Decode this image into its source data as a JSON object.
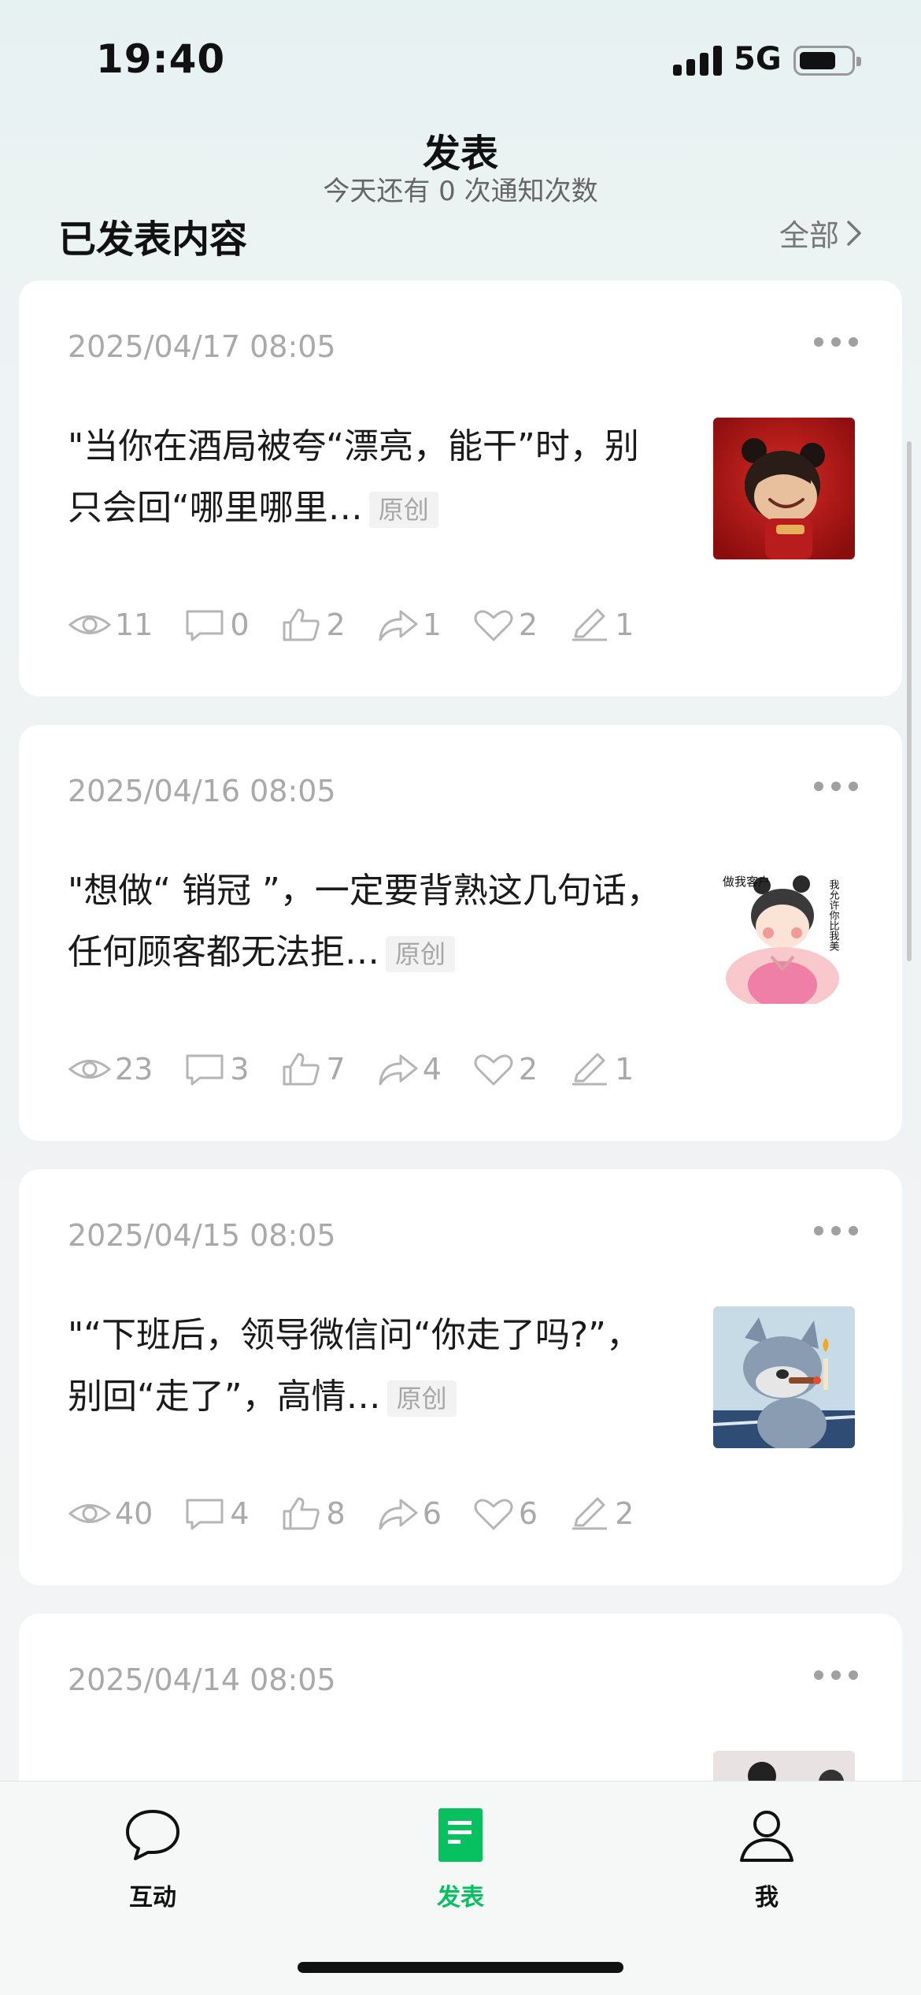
{
  "status_bar": {
    "time": "19:40",
    "network": "5G"
  },
  "header": {
    "title": "发表",
    "subtitle": "今天还有 0 次通知次数",
    "section_title": "已发表内容",
    "see_all": "全部"
  },
  "tag_label": "原创",
  "posts": [
    {
      "date": "2025/04/17 08:05",
      "text": "\"当你在酒局被夸“漂亮，能干”时，别只会回“哪里哪里…",
      "tag": "原创",
      "stats": {
        "views": "11",
        "comments": "0",
        "likes": "2",
        "shares": "1",
        "favorites": "2",
        "edits": "1"
      }
    },
    {
      "date": "2025/04/16 08:05",
      "text": "\"想做“ 销冠 ”，一定要背熟这几句话，任何顾客都无法拒…",
      "tag": "原创",
      "thumb_text_right": "我允许你比我美",
      "thumb_text_left": "做我客户",
      "stats": {
        "views": "23",
        "comments": "3",
        "likes": "7",
        "shares": "4",
        "favorites": "2",
        "edits": "1"
      }
    },
    {
      "date": "2025/04/15 08:05",
      "text": "\"“下班后，领导微信问“你走了吗?”，别回“走了”，高情…",
      "tag": "原创",
      "stats": {
        "views": "40",
        "comments": "4",
        "likes": "8",
        "shares": "6",
        "favorites": "6",
        "edits": "2"
      }
    },
    {
      "date": "2025/04/14 08:05"
    }
  ],
  "tabs": [
    {
      "label": "互动",
      "icon": "chat-bubble-icon"
    },
    {
      "label": "发表",
      "icon": "document-icon",
      "active": true
    },
    {
      "label": "我",
      "icon": "person-icon"
    }
  ],
  "colors": {
    "accent": "#07c160",
    "muted": "#a9a9a9"
  }
}
